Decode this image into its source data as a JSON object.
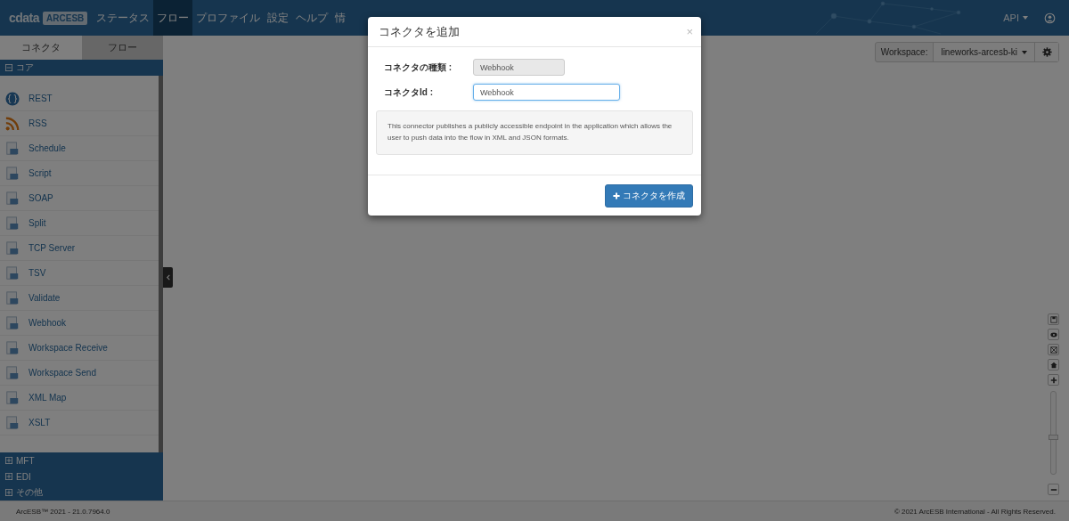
{
  "header": {
    "logo": {
      "brand": "cdata",
      "product": "ARCESB"
    },
    "nav": [
      {
        "label": "ステータス",
        "selected": false
      },
      {
        "label": "フロー",
        "selected": true
      },
      {
        "label": "プロファイル",
        "selected": false
      },
      {
        "label": "設定",
        "selected": false
      },
      {
        "label": "ヘルプ",
        "selected": false
      },
      {
        "label": "情",
        "selected": false
      }
    ],
    "api_menu": "API"
  },
  "sidebar": {
    "tabs": [
      {
        "label": "コネクタ",
        "selected": true
      },
      {
        "label": "フロー",
        "selected": false
      }
    ],
    "groups": [
      {
        "label": "コア",
        "expanded": true,
        "items": [
          "REST",
          "RSS",
          "Schedule",
          "Script",
          "SOAP",
          "Split",
          "TCP Server",
          "TSV",
          "Validate",
          "Webhook",
          "Workspace Receive",
          "Workspace Send",
          "XML Map",
          "XSLT"
        ]
      },
      {
        "label": "MFT",
        "expanded": false
      },
      {
        "label": "EDI",
        "expanded": false
      },
      {
        "label": "その他",
        "expanded": false
      }
    ]
  },
  "workspace": {
    "label": "Workspace:",
    "value": "lineworks-arcesb-ki"
  },
  "zoom": {
    "level": 0.45
  },
  "modal": {
    "title": "コネクタを追加",
    "close": "×",
    "fields": [
      {
        "label": "コネクタの種類 :",
        "value": "Webhook",
        "disabled": true
      },
      {
        "label": "コネクタId :",
        "value": "Webhook",
        "disabled": false
      }
    ],
    "description": "This connector publishes a publicly accessible endpoint in the application which allows the user to push data into the flow in XML and JSON formats.",
    "button": "コネクタを作成"
  },
  "footer": {
    "left": "ArcESB™ 2021 - 21.0.7964.0",
    "right": "© 2021 ArcESB International - All Rights Reserved."
  }
}
